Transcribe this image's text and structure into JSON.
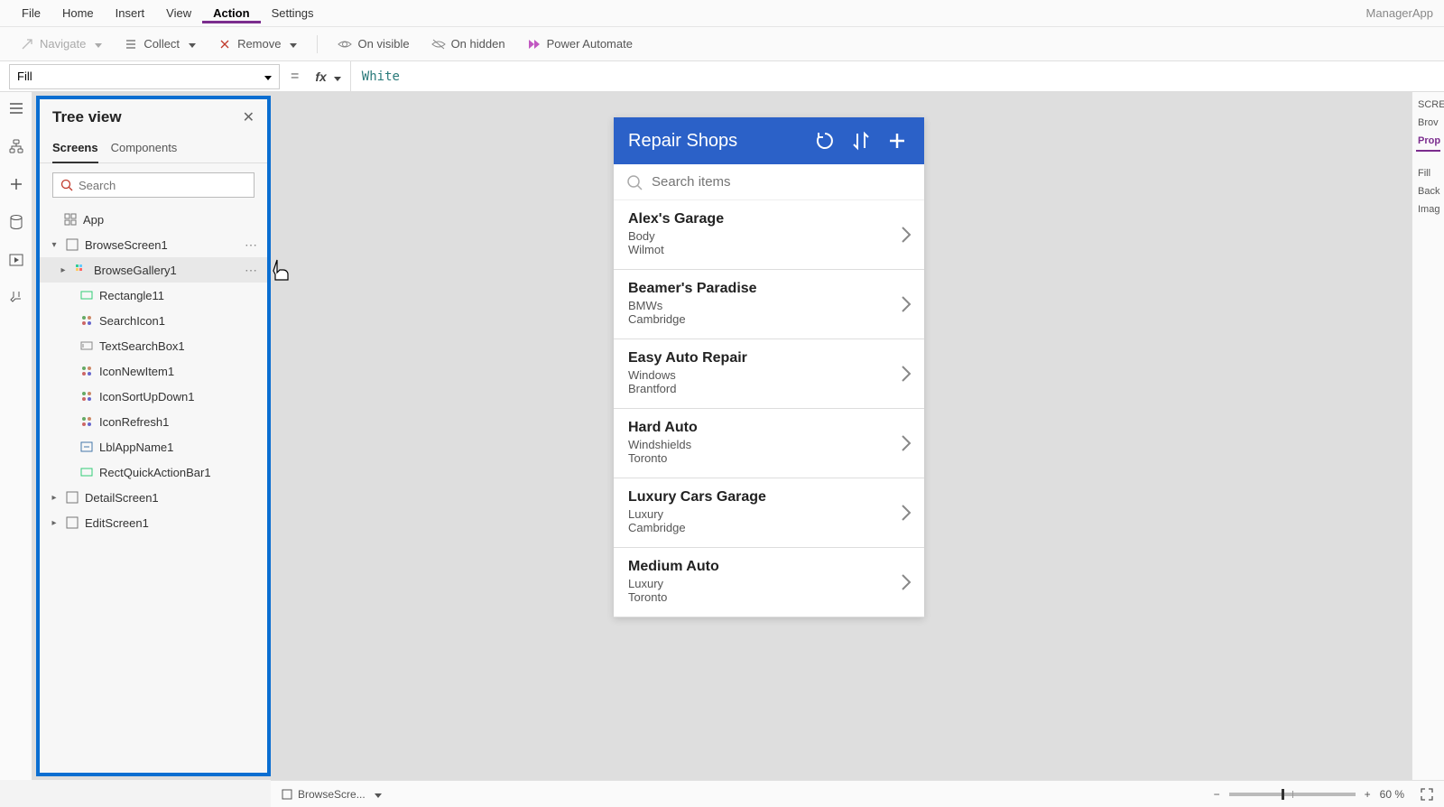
{
  "appName": "ManagerApp",
  "menus": [
    "File",
    "Home",
    "Insert",
    "View",
    "Action",
    "Settings"
  ],
  "activeMenu": "Action",
  "actions": {
    "navigate": "Navigate",
    "collect": "Collect",
    "remove": "Remove",
    "visible": "On visible",
    "hidden": "On hidden",
    "powerAutomate": "Power Automate"
  },
  "formulaBar": {
    "property": "Fill",
    "formula": "White"
  },
  "treeView": {
    "title": "Tree view",
    "tabs": [
      "Screens",
      "Components"
    ],
    "activeTab": "Screens",
    "searchPlaceholder": "Search",
    "nodes": {
      "app": "App",
      "browseScreen": "BrowseScreen1",
      "gallery": "BrowseGallery1",
      "children": [
        "Rectangle11",
        "SearchIcon1",
        "TextSearchBox1",
        "IconNewItem1",
        "IconSortUpDown1",
        "IconRefresh1",
        "LblAppName1",
        "RectQuickActionBar1"
      ],
      "detail": "DetailScreen1",
      "edit": "EditScreen1"
    }
  },
  "phone": {
    "title": "Repair Shops",
    "searchPlaceholder": "Search items",
    "items": [
      {
        "title": "Alex's Garage",
        "sub1": "Body",
        "sub2": "Wilmot"
      },
      {
        "title": "Beamer's Paradise",
        "sub1": "BMWs",
        "sub2": "Cambridge"
      },
      {
        "title": "Easy Auto Repair",
        "sub1": "Windows",
        "sub2": "Brantford"
      },
      {
        "title": "Hard Auto",
        "sub1": "Windshields",
        "sub2": "Toronto"
      },
      {
        "title": "Luxury Cars Garage",
        "sub1": "Luxury",
        "sub2": "Cambridge"
      },
      {
        "title": "Medium Auto",
        "sub1": "Luxury",
        "sub2": "Toronto"
      }
    ]
  },
  "propPanel": {
    "header": "SCRE",
    "name": "Brov",
    "tab": "Prop",
    "rows": [
      "Fill",
      "Back",
      "Imag"
    ]
  },
  "status": {
    "screen": "BrowseScre...",
    "zoom": "60 %"
  }
}
